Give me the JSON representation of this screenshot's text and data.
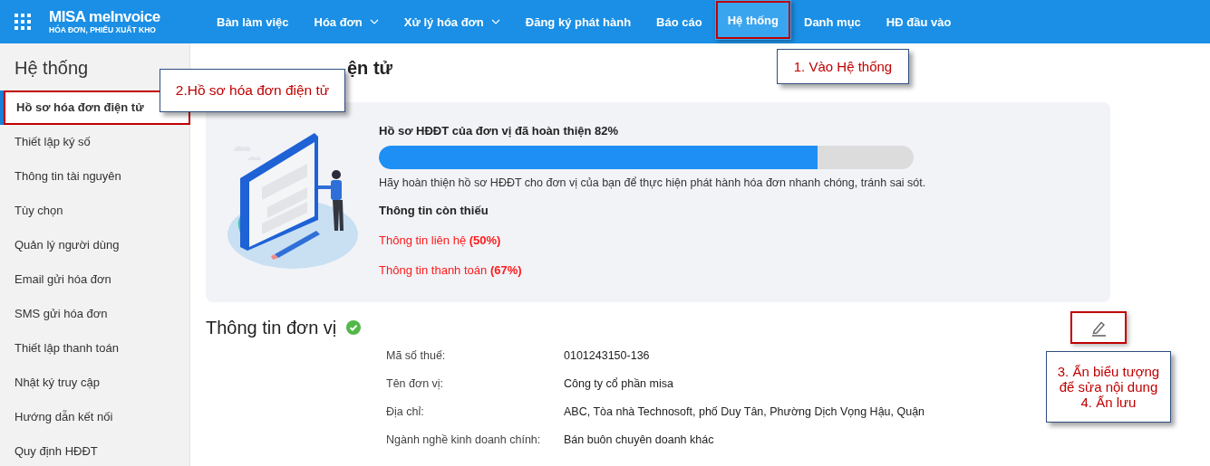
{
  "app": {
    "logo_name": "MISA meInvoice",
    "logo_subtitle": "HÓA ĐƠN, PHIẾU XUẤT KHO"
  },
  "nav": [
    {
      "label": "Bàn làm việc",
      "has_menu": false,
      "selected": false,
      "highlighted": false
    },
    {
      "label": "Hóa đơn",
      "has_menu": true,
      "selected": false,
      "highlighted": false
    },
    {
      "label": "Xử lý hóa đơn",
      "has_menu": true,
      "selected": false,
      "highlighted": false
    },
    {
      "label": "Đăng ký phát hành",
      "has_menu": false,
      "selected": false,
      "highlighted": false
    },
    {
      "label": "Báo cáo",
      "has_menu": false,
      "selected": false,
      "highlighted": false
    },
    {
      "label": "Hệ thống",
      "has_menu": false,
      "selected": true,
      "highlighted": true
    },
    {
      "label": "Danh mục",
      "has_menu": false,
      "selected": false,
      "highlighted": false
    },
    {
      "label": "HĐ đầu vào",
      "has_menu": false,
      "selected": false,
      "highlighted": false
    }
  ],
  "sidebar": {
    "title": "Hệ thống",
    "items": [
      {
        "label": "Hồ sơ hóa đơn điện tử",
        "selected": true,
        "highlighted": true
      },
      {
        "label": "Thiết lập ký số",
        "selected": false,
        "highlighted": false
      },
      {
        "label": "Thông tin tài nguyên",
        "selected": false,
        "highlighted": false
      },
      {
        "label": "Tùy chọn",
        "selected": false,
        "highlighted": false
      },
      {
        "label": "Quản lý người dùng",
        "selected": false,
        "highlighted": false
      },
      {
        "label": "Email gửi hóa đơn",
        "selected": false,
        "highlighted": false
      },
      {
        "label": "SMS gửi hóa đơn",
        "selected": false,
        "highlighted": false
      },
      {
        "label": "Thiết lập thanh toán",
        "selected": false,
        "highlighted": false
      },
      {
        "label": "Nhật ký truy cập",
        "selected": false,
        "highlighted": false
      },
      {
        "label": "Hướng dẫn kết nối",
        "selected": false,
        "highlighted": false
      },
      {
        "label": "Quy định HĐĐT",
        "selected": false,
        "highlighted": false
      }
    ]
  },
  "page_title": "ện tử",
  "completion_card": {
    "heading": "Hồ sơ HĐĐT của đơn vị đã hoàn thiện 82%",
    "progress": {
      "level": 0.82
    },
    "hint": "Hãy hoàn thiện hồ sơ HĐĐT cho đơn vị của bạn để thực hiện phát hành hóa đơn nhanh chóng, tránh sai sót.",
    "missing_title": "Thông tin còn thiếu",
    "missing_items": [
      "Thông tin liên hệ **(50%)**",
      "Thông tin thanh toán **(67%)**"
    ]
  },
  "unit_info": {
    "title": "Thông tin đơn vị",
    "complete": true,
    "edit_highlighted": true,
    "fields": [
      {
        "label": "Mã số thuế:",
        "value": "0101243150-136"
      },
      {
        "label": "Tên đơn vị:",
        "value": "Công ty cổ phần misa"
      },
      {
        "label": "Địa chỉ:",
        "value": "ABC, Tòa nhà Technosoft, phố Duy Tân, Phường Dịch Vọng Hậu, Quận"
      },
      {
        "label": "Ngành nghề kinh doanh chính:",
        "value": "Bán buôn chuyên doanh khác"
      }
    ]
  },
  "annotations": [
    {
      "kind": "nav",
      "lines": [
        "1. Vào Hệ thống"
      ]
    },
    {
      "kind": "sidebar",
      "lines": [
        "2.Hồ sơ hóa đơn điện tử"
      ]
    },
    {
      "kind": "edit",
      "lines": [
        "3. Ấn biểu tượng",
        "để sửa nội dung",
        "4. Ấn lưu"
      ]
    }
  ]
}
